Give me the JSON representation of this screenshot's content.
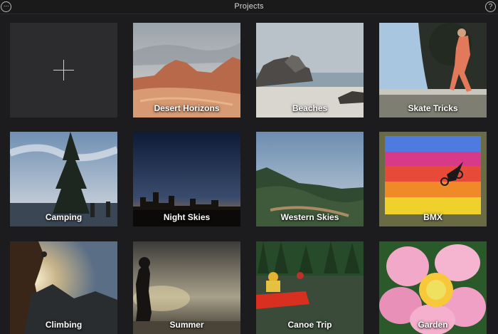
{
  "topbar": {
    "title": "Projects",
    "more_glyph": "···",
    "help_glyph": "?"
  },
  "new_project": {
    "icon": "plus-icon"
  },
  "projects": [
    {
      "label": "Desert Horizons"
    },
    {
      "label": "Beaches"
    },
    {
      "label": "Skate Tricks"
    },
    {
      "label": "Camping"
    },
    {
      "label": "Night Skies"
    },
    {
      "label": "Western Skies"
    },
    {
      "label": "BMX"
    },
    {
      "label": "Climbing"
    },
    {
      "label": "Summer"
    },
    {
      "label": "Canoe Trip"
    },
    {
      "label": "Garden"
    }
  ]
}
